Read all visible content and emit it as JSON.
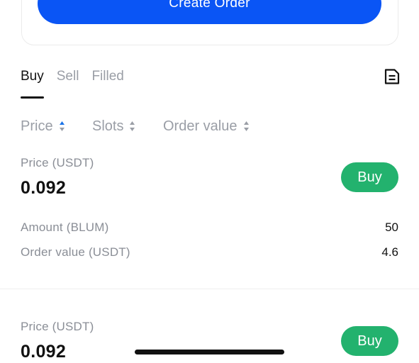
{
  "create_order": {
    "label": "Create Order"
  },
  "tabs": [
    {
      "label": "Buy",
      "active": true
    },
    {
      "label": "Sell",
      "active": false
    },
    {
      "label": "Filled",
      "active": false
    }
  ],
  "sort_columns": [
    {
      "label": "Price",
      "active": true
    },
    {
      "label": "Slots",
      "active": false
    },
    {
      "label": "Order value",
      "active": false
    }
  ],
  "orders": [
    {
      "price_label": "Price (USDT)",
      "price": "0.092",
      "amount_label": "Amount (BLUM)",
      "amount": "50",
      "order_value_label": "Order value (USDT)",
      "order_value": "4.6",
      "action_label": "Buy"
    },
    {
      "price_label": "Price (USDT)",
      "price": "0.092",
      "action_label": "Buy"
    }
  ],
  "icons": {
    "history": "document-list-icon",
    "sort": "sort-arrows-icon"
  },
  "colors": {
    "primary": "#0a55f5",
    "buy": "#23b26e",
    "sort_active": "#1a73e8",
    "muted": "#9a9ea6"
  }
}
